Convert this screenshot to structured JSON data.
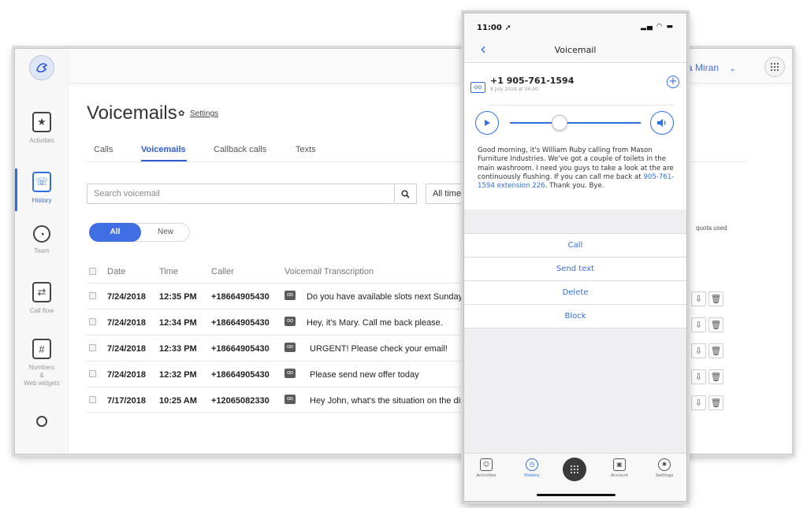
{
  "header": {
    "user_name_fragment": "a Miran",
    "user_chevron": "⌄"
  },
  "sidebar": {
    "items": [
      {
        "label": "Activities",
        "icon": "star-icon"
      },
      {
        "label": "History",
        "icon": "history-icon"
      },
      {
        "label": "Team",
        "icon": "team-icon"
      },
      {
        "label": "Call flow",
        "icon": "call-flow-icon"
      },
      {
        "label": "Numbers\n&\nWeb widgets",
        "icon": "numbers-icon"
      },
      {
        "label": "",
        "icon": "help-icon"
      }
    ]
  },
  "page": {
    "title": "Voicemails",
    "settings_label": "Settings",
    "tabs": [
      "Calls",
      "Voicemails",
      "Callback calls",
      "Texts"
    ],
    "active_tab": "Voicemails",
    "search_placeholder": "Search voicemail",
    "time_filter": "All time",
    "toggle": {
      "all": "All",
      "new": "New"
    },
    "quota_fragment": "quota used"
  },
  "table": {
    "headers": [
      "Date",
      "Time",
      "Caller",
      "Voicemail Transcription"
    ],
    "rows": [
      {
        "date": "7/24/2018",
        "time": "12:35 PM",
        "caller": "+18664905430",
        "transcription": "Do you have available slots next Sunday?"
      },
      {
        "date": "7/24/2018",
        "time": "12:34 PM",
        "caller": "+18664905430",
        "transcription": "Hey, it's Mary. Call me back please."
      },
      {
        "date": "7/24/2018",
        "time": "12:33 PM",
        "caller": "+18664905430",
        "transcription": "URGENT! Please check your email!"
      },
      {
        "date": "7/24/2018",
        "time": "12:32 PM",
        "caller": "+18664905430",
        "transcription": "Please send new offer today"
      },
      {
        "date": "7/17/2018",
        "time": "10:25 AM",
        "caller": "+12065082330",
        "transcription": "Hey John, what's the situation on the disc"
      }
    ]
  },
  "phone": {
    "status_time": "11:00",
    "nav_title": "Voicemail",
    "voicemail": {
      "number": "+1 905-761-1594",
      "date": "8 July 2019 at 04:50",
      "playback_progress": 0.38,
      "transcript_text": "Good morning, it's William Ruby calling from Mason Furniture Industries. We've got a couple of toilets in the main washroom. I need you guys to take a look at the are continuously flushing. If you can call me back at ",
      "transcript_link": "905-761-1594 extension 226",
      "transcript_tail": ". Thank you. Bye."
    },
    "actions": [
      "Call",
      "Send text",
      "Delete",
      "Block"
    ],
    "tabbar": [
      {
        "label": "Activities",
        "icon": "activities-icon"
      },
      {
        "label": "History",
        "icon": "history-icon"
      },
      {
        "label": "",
        "icon": "dialpad-icon"
      },
      {
        "label": "Account",
        "icon": "account-icon"
      },
      {
        "label": "Settings",
        "icon": "gear-icon"
      }
    ]
  },
  "colors": {
    "accent": "#2f6fe0",
    "toggle_active": "#3f6fe3",
    "text_dark": "#222222"
  }
}
